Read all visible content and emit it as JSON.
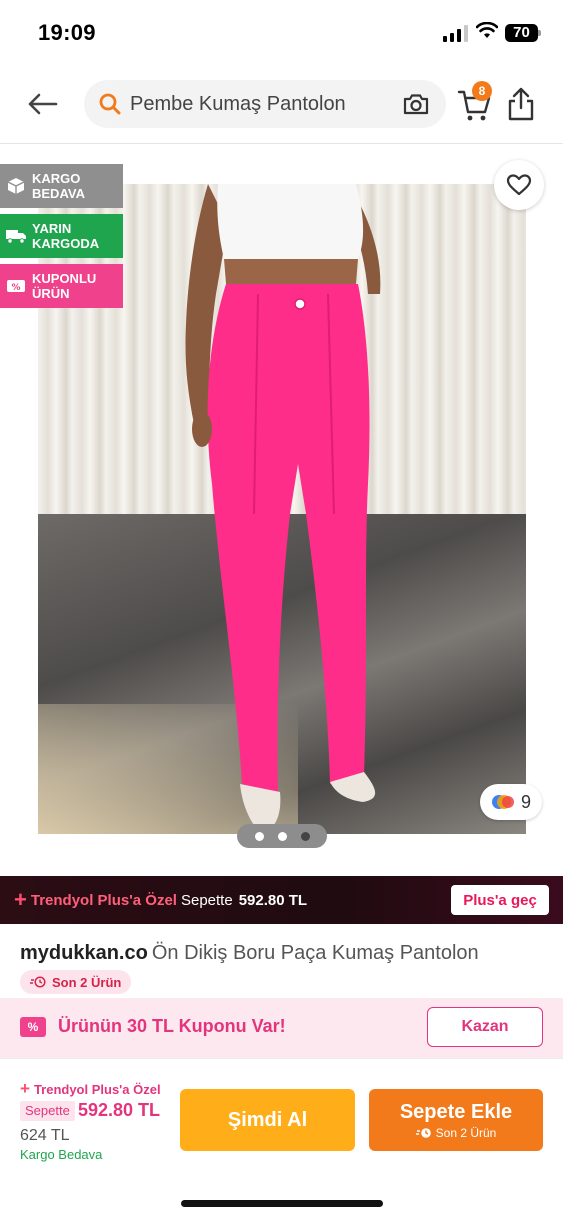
{
  "status_bar": {
    "time": "19:09",
    "battery": "70"
  },
  "header": {
    "search_text": "Pembe Kumaş Pantolon",
    "cart_count": "8"
  },
  "gallery": {
    "badges": [
      {
        "line1": "KARGO",
        "line2": "BEDAVA",
        "color": "#8f8f8f"
      },
      {
        "line1": "YARIN",
        "line2": "KARGODA",
        "color": "#1ea54e"
      },
      {
        "line1": "KUPONLU",
        "line2": "ÜRÜN",
        "color": "#f0428c"
      }
    ],
    "color_count": "9",
    "dots": 3,
    "active_dot": 2
  },
  "plus_banner": {
    "mark": "+",
    "title": "Trendyol Plus'a Özel",
    "sub": "Sepette",
    "price": "592.80 TL",
    "button": "Plus'a geç"
  },
  "product": {
    "brand": "mydukkan.co",
    "name": "Ön Dikiş Boru Paça Kumaş Pantolon",
    "stock": "Son 2 Ürün"
  },
  "coupon": {
    "icon_text": "%",
    "text": "Ürünün 30 TL Kuponu Var!",
    "button": "Kazan"
  },
  "bottom": {
    "plus_label": "Trendyol Plus'a Özel",
    "sepette": "Sepette",
    "price": "592.80 TL",
    "old_price": "624 TL",
    "kargo": "Kargo Bedava",
    "buy_now": "Şimdi Al",
    "add_to_cart": "Sepete Ekle",
    "cart_sub": "Son 2 Ürün"
  },
  "colors": {
    "brand_orange": "#f27a1a",
    "buy_yellow": "#ffae1a",
    "pink": "#e3357d",
    "green": "#1ea54e",
    "product_pink": "#ff2d8a"
  }
}
